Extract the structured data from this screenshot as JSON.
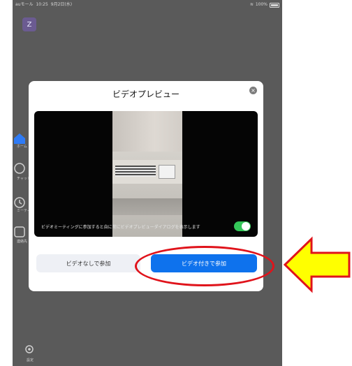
{
  "status_bar": {
    "carrier": "auモール",
    "time": "10:25",
    "date": "9月2日(水)",
    "battery": "100%"
  },
  "avatar": {
    "initial": "Z"
  },
  "sidebar": {
    "items": [
      {
        "icon": "home-icon",
        "label": "ホーム"
      },
      {
        "icon": "chat-icon",
        "label": "チャット"
      },
      {
        "icon": "clock-icon",
        "label": "ミーティング"
      },
      {
        "icon": "contacts-icon",
        "label": "連絡先"
      },
      {
        "icon": "gear-icon",
        "label": "設定"
      }
    ]
  },
  "dialog": {
    "title": "ビデオプレビュー",
    "close_icon": "close-icon",
    "toggle_label": "ビデオミーティングに参加すると自に常にビデオプレビューダイアログを表示します",
    "toggle_on": true,
    "btn_without_video": "ビデオなしで参加",
    "btn_with_video": "ビデオ付きで参加"
  },
  "colors": {
    "device_bg": "#5a5a5a",
    "accent_blue": "#0e72ed",
    "toggle_green": "#34c759",
    "annotation_red": "#e0131b",
    "arrow_yellow": "#ffff00"
  }
}
